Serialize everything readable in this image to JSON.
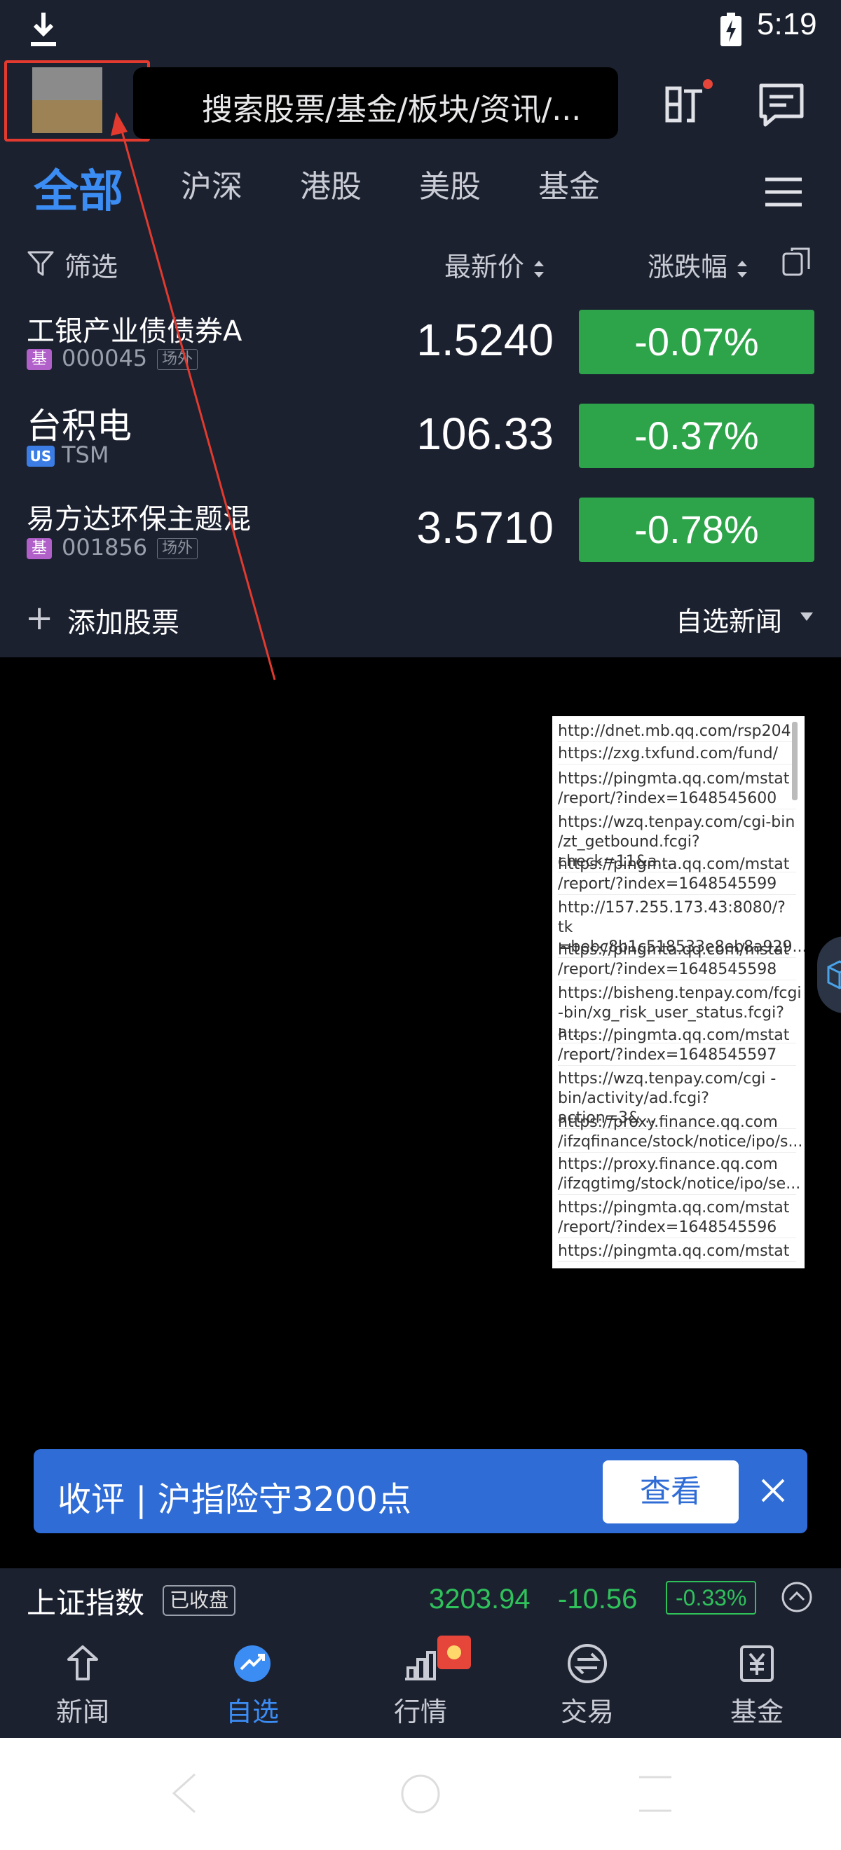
{
  "status_bar": {
    "time": "5:19"
  },
  "header": {
    "search_placeholder": "搜索股票/基金/板块/资讯/...",
    "monitor_icon": "monitor-icon",
    "message_icon": "message-icon"
  },
  "tabs": [
    {
      "label": "全部",
      "active": true
    },
    {
      "label": "沪深"
    },
    {
      "label": "港股"
    },
    {
      "label": "美股"
    },
    {
      "label": "基金"
    }
  ],
  "columns": {
    "filter": "筛选",
    "price": "最新价",
    "change": "涨跌幅"
  },
  "watchlist": [
    {
      "name": "工银产业债债券A",
      "tag": "基",
      "code": "000045",
      "market": "场外",
      "price": "1.5240",
      "change": "-0.07%"
    },
    {
      "name": "台积电",
      "tag": "US",
      "code": "TSM",
      "price": "106.33",
      "change": "-0.37%"
    },
    {
      "name": "易方达环保主题混",
      "tag": "基",
      "code": "001856",
      "market": "场外",
      "price": "3.5710",
      "change": "-0.78%"
    }
  ],
  "add_stock": "添加股票",
  "watch_news": "自选新闻",
  "url_list": [
    "http://dnet.mb.qq.com/rsp204",
    "https://zxg.txfund.com/fund/",
    "https://pingmta.qq.com/mstat /report/?index=1648545600",
    "https://wzq.tenpay.com/cgi-bin /zt_getbound.fcgi?check=11&a...",
    "https://pingmta.qq.com/mstat /report/?index=1648545599",
    "http://157.255.173.43:8080/?tk =bebc8b1c518533e8eb8a929...",
    "https://pingmta.qq.com/mstat /report/?index=1648545598",
    "https://bisheng.tenpay.com/fcgi -bin/xg_risk_user_status.fcgi?a...",
    "https://pingmta.qq.com/mstat /report/?index=1648545597",
    "https://wzq.tenpay.com/cgi -bin/activity/ad.fcgi?action=3&...",
    "https://proxy.finance.qq.com /ifzqfinance/stock/notice/ipo/s...",
    "https://proxy.finance.qq.com /ifzqgtimg/stock/notice/ipo/se...",
    "https://pingmta.qq.com/mstat /report/?index=1648545596",
    "https://pingmta.qq.com/mstat"
  ],
  "banner": {
    "text": "收评 | 沪指险守3200点",
    "button": "查看"
  },
  "index_bar": {
    "name": "上证指数",
    "status": "已收盘",
    "value": "3203.94",
    "change": "-10.56",
    "percent": "-0.33%"
  },
  "bottom_nav": [
    {
      "label": "新闻",
      "icon": "news-icon"
    },
    {
      "label": "自选",
      "icon": "watchlist-icon",
      "active": true
    },
    {
      "label": "行情",
      "icon": "market-icon"
    },
    {
      "label": "交易",
      "icon": "trade-icon"
    },
    {
      "label": "基金",
      "icon": "fund-icon"
    }
  ],
  "colors": {
    "accent": "#3b8cf3",
    "down": "#2ea44a",
    "annotation": "#e23a2e",
    "bg": "#1c2130"
  }
}
